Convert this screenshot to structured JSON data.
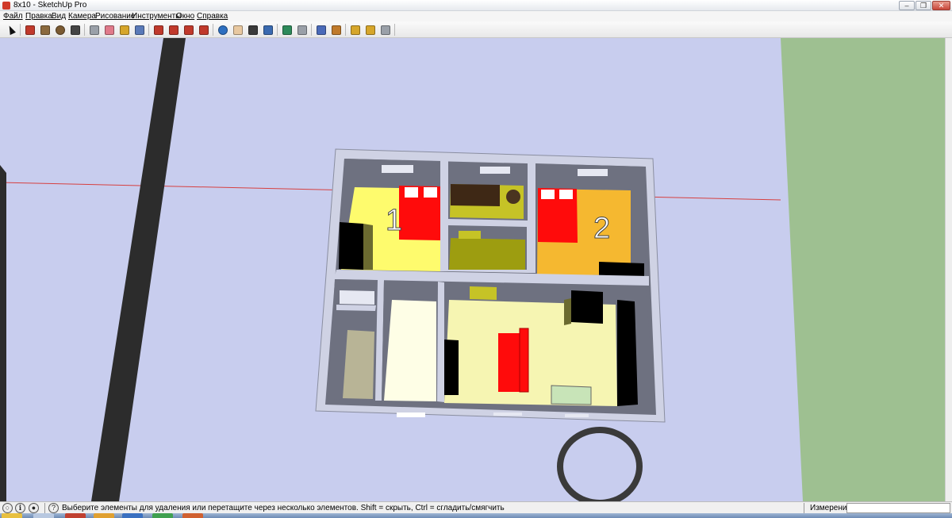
{
  "window": {
    "title": "8x10 - SketchUp Pro",
    "minimize_icon": "minimize-icon",
    "maximize_icon": "restore-icon",
    "close_icon": "close-icon"
  },
  "menu": {
    "items": [
      "Файл",
      "Правка",
      "Вид",
      "Камера",
      "Рисование",
      "Инструменты",
      "Окно",
      "Справка"
    ]
  },
  "toolbar": {
    "tools": [
      {
        "name": "select-tool",
        "icon": "arrow-cursor-icon"
      },
      {
        "name": "line-tool",
        "icon": "pencil-icon",
        "color": "#c0392b"
      },
      {
        "name": "rectangle-tool",
        "icon": "rectangle-icon",
        "color": "#8b6a3e"
      },
      {
        "name": "circle-tool",
        "icon": "circle-icon",
        "color": "#7a5a32"
      },
      {
        "name": "arc-tool",
        "icon": "arc-icon",
        "color": "#444444"
      },
      {
        "name": "make-component-tool",
        "icon": "component-icon",
        "color": "#9aa0a8"
      },
      {
        "name": "eraser-tool",
        "icon": "eraser-icon",
        "color": "#e07a8a"
      },
      {
        "name": "tape-measure-tool",
        "icon": "tape-measure-icon",
        "color": "#d6a62a"
      },
      {
        "name": "paint-bucket-tool",
        "icon": "paint-bucket-icon",
        "color": "#5a7ab8"
      },
      {
        "name": "push-pull-tool",
        "icon": "push-pull-icon",
        "color": "#c0392b"
      },
      {
        "name": "move-tool",
        "icon": "move-icon",
        "color": "#c0392b"
      },
      {
        "name": "rotate-tool",
        "icon": "rotate-icon",
        "color": "#c0392b"
      },
      {
        "name": "offset-tool",
        "icon": "offset-icon",
        "color": "#c0392b"
      },
      {
        "name": "orbit-tool",
        "icon": "orbit-icon",
        "color": "#2d6fc0"
      },
      {
        "name": "pan-tool",
        "icon": "hand-icon",
        "color": "#e8c8a0"
      },
      {
        "name": "zoom-tool",
        "icon": "magnifier-icon",
        "color": "#3a3a3a"
      },
      {
        "name": "zoom-extents-tool",
        "icon": "zoom-extents-icon",
        "color": "#3a6ab0"
      },
      {
        "name": "section-plane-tool",
        "icon": "section-plane-icon",
        "color": "#2d8a5a"
      },
      {
        "name": "dimension-tool",
        "icon": "dimension-icon",
        "color": "#9aa0a8"
      },
      {
        "name": "walk-tool",
        "icon": "walk-icon",
        "color": "#4a6ab8"
      },
      {
        "name": "position-camera-tool",
        "icon": "camera-position-icon",
        "color": "#c07a2a"
      },
      {
        "name": "get-models-tool",
        "icon": "warehouse-icon",
        "color": "#d6a62a"
      },
      {
        "name": "share-model-tool",
        "icon": "share-icon",
        "color": "#d6a62a"
      },
      {
        "name": "components-tool",
        "icon": "components-icon",
        "color": "#9aa0a8"
      }
    ]
  },
  "scene": {
    "room_labels": [
      "1",
      "2"
    ],
    "colors": {
      "sky": "#c8cdee",
      "ground": "#9ec091",
      "walls": "#cfd2e4",
      "wall_shadow": "#6e7180",
      "bedroom1_floor": "#fefb6d",
      "bedroom2_floor": "#f5b830",
      "kitchen_floor": "#f6f5b2",
      "bath_floor": "#b8b496",
      "hall_floor": "#fefee6",
      "small_room_floor": "#9d9d10",
      "bed": "#ff0b0b",
      "furniture_dark": "#000000",
      "axis_red": "#d64040"
    }
  },
  "status": {
    "icons": [
      "geolocation-icon",
      "credits-icon",
      "user-icon",
      "help-icon"
    ],
    "hint": "Выберите элементы для удаления или перетащите через несколько элементов. Shift = скрыть, Ctrl = сгладить/смягчить",
    "measurements_label": "Измерения",
    "measurements_value": ""
  }
}
